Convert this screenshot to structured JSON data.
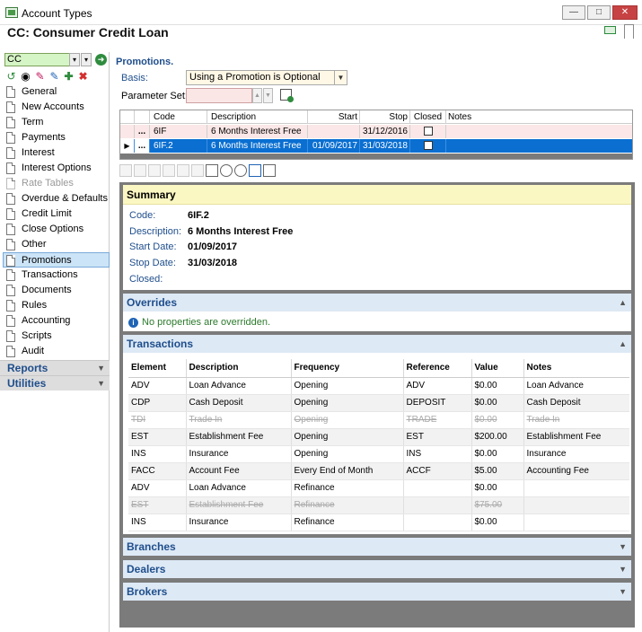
{
  "window": {
    "title": "Account Types"
  },
  "header": {
    "title": "CC: Consumer Credit Loan"
  },
  "sidebar": {
    "code_value": "CC",
    "items": [
      {
        "label": "General"
      },
      {
        "label": "New Accounts"
      },
      {
        "label": "Term"
      },
      {
        "label": "Payments"
      },
      {
        "label": "Interest"
      },
      {
        "label": "Interest Options"
      },
      {
        "label": "Rate Tables"
      },
      {
        "label": "Overdue & Defaults"
      },
      {
        "label": "Credit Limit"
      },
      {
        "label": "Close Options"
      },
      {
        "label": "Other"
      },
      {
        "label": "Promotions"
      },
      {
        "label": "Transactions"
      },
      {
        "label": "Documents"
      },
      {
        "label": "Rules"
      },
      {
        "label": "Accounting"
      },
      {
        "label": "Scripts"
      },
      {
        "label": "Audit"
      }
    ],
    "groups": [
      {
        "label": "Reports"
      },
      {
        "label": "Utilities"
      }
    ]
  },
  "promotions": {
    "title": "Promotions.",
    "basis_label": "Basis:",
    "basis_value": "Using a Promotion is Optional",
    "pset_label": "Parameter Set:",
    "columns": [
      "Code",
      "Description",
      "Start",
      "Stop",
      "Closed",
      "Notes"
    ],
    "rows": [
      {
        "btn": "...",
        "code": "6IF",
        "description": "6 Months Interest Free",
        "start": "",
        "stop": "31/12/2016",
        "notes": ""
      },
      {
        "btn": "...",
        "code": "6IF.2",
        "description": "6 Months Interest Free",
        "start": "01/09/2017",
        "stop": "31/03/2018",
        "notes": ""
      }
    ]
  },
  "summary": {
    "title": "Summary",
    "code_label": "Code:",
    "code": "6IF.2",
    "desc_label": "Description:",
    "description": "6 Months Interest Free",
    "start_label": "Start Date:",
    "start": "01/09/2017",
    "stop_label": "Stop Date:",
    "stop": "31/03/2018",
    "closed_label": "Closed:"
  },
  "overrides": {
    "title": "Overrides",
    "message": "No properties are overridden."
  },
  "transactions": {
    "title": "Transactions",
    "columns": [
      "Element",
      "Description",
      "Frequency",
      "Reference",
      "Value",
      "Notes"
    ],
    "rows": [
      [
        "ADV",
        "Loan Advance",
        "Opening",
        "ADV",
        "$0.00",
        "Loan Advance"
      ],
      [
        "CDP",
        "Cash Deposit",
        "Opening",
        "DEPOSIT",
        "$0.00",
        "Cash Deposit"
      ],
      [
        "TDI",
        "Trade In",
        "Opening",
        "TRADE",
        "$0.00",
        "Trade In"
      ],
      [
        "EST",
        "Establishment Fee",
        "Opening",
        "EST",
        "$200.00",
        "Establishment Fee"
      ],
      [
        "INS",
        "Insurance",
        "Opening",
        "INS",
        "$0.00",
        "Insurance"
      ],
      [
        "FACC",
        "Account Fee",
        "Every End of Month",
        "ACCF",
        "$5.00",
        "Accounting Fee"
      ],
      [
        "ADV",
        "Loan Advance",
        "Refinance",
        "",
        "$0.00",
        ""
      ],
      [
        "EST",
        "Establishment Fee",
        "Refinance",
        "",
        "$75.00",
        ""
      ],
      [
        "INS",
        "Insurance",
        "Refinance",
        "",
        "$0.00",
        ""
      ]
    ]
  },
  "sections": [
    {
      "title": "Branches"
    },
    {
      "title": "Dealers"
    },
    {
      "title": "Brokers"
    }
  ]
}
